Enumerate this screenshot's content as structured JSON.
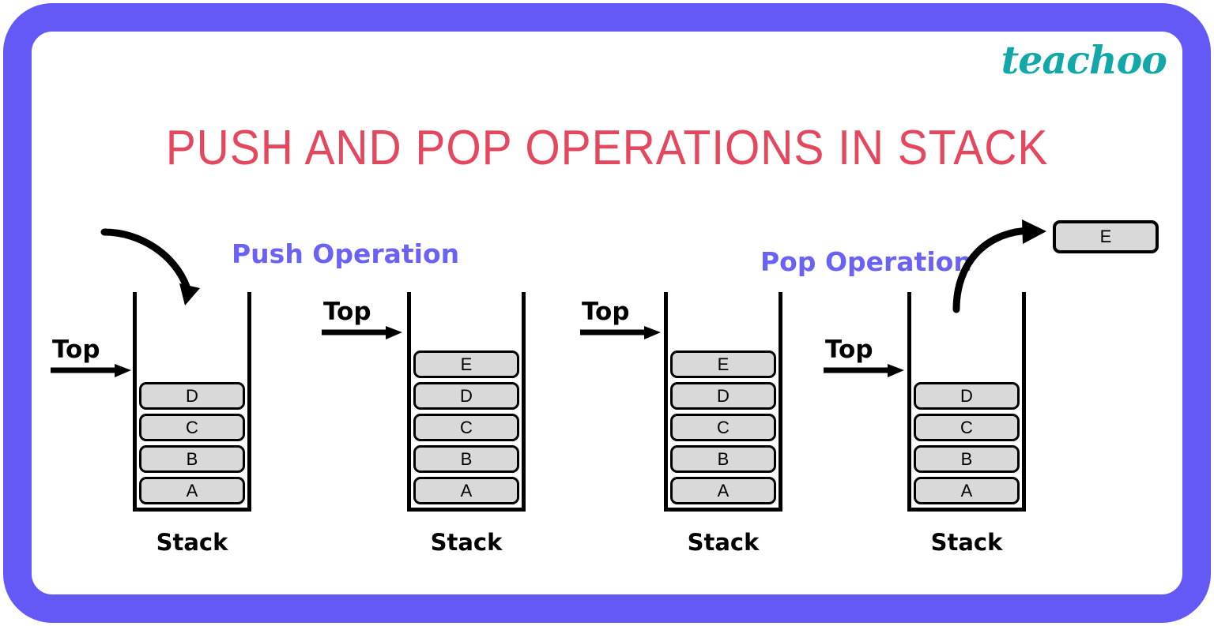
{
  "brand": {
    "name": "teachoo",
    "color": "#12a8a8"
  },
  "frame": {
    "color": "#6459f7"
  },
  "title": {
    "text": "PUSH AND POP OPERATIONS IN STACK",
    "color": "#e4485e"
  },
  "operations": {
    "push_label": "Push Operation",
    "pop_label": "Pop Operation",
    "label_color": "#6a62f5"
  },
  "pointer": {
    "label": "Top"
  },
  "stack_caption": "Stack",
  "popped_element": {
    "value": "E"
  },
  "stacks": [
    {
      "id": "stack-before-push",
      "caption": "Stack",
      "top_label": "Top",
      "top_points_to": "D",
      "cells": [
        "D",
        "C",
        "B",
        "A"
      ]
    },
    {
      "id": "stack-after-push",
      "caption": "Stack",
      "top_label": "Top",
      "top_points_to": "E",
      "cells": [
        "E",
        "D",
        "C",
        "B",
        "A"
      ]
    },
    {
      "id": "stack-before-pop",
      "caption": "Stack",
      "top_label": "Top",
      "top_points_to": "E",
      "cells": [
        "E",
        "D",
        "C",
        "B",
        "A"
      ]
    },
    {
      "id": "stack-after-pop",
      "caption": "Stack",
      "top_label": "Top",
      "top_points_to": "D",
      "cells": [
        "D",
        "C",
        "B",
        "A"
      ]
    }
  ]
}
